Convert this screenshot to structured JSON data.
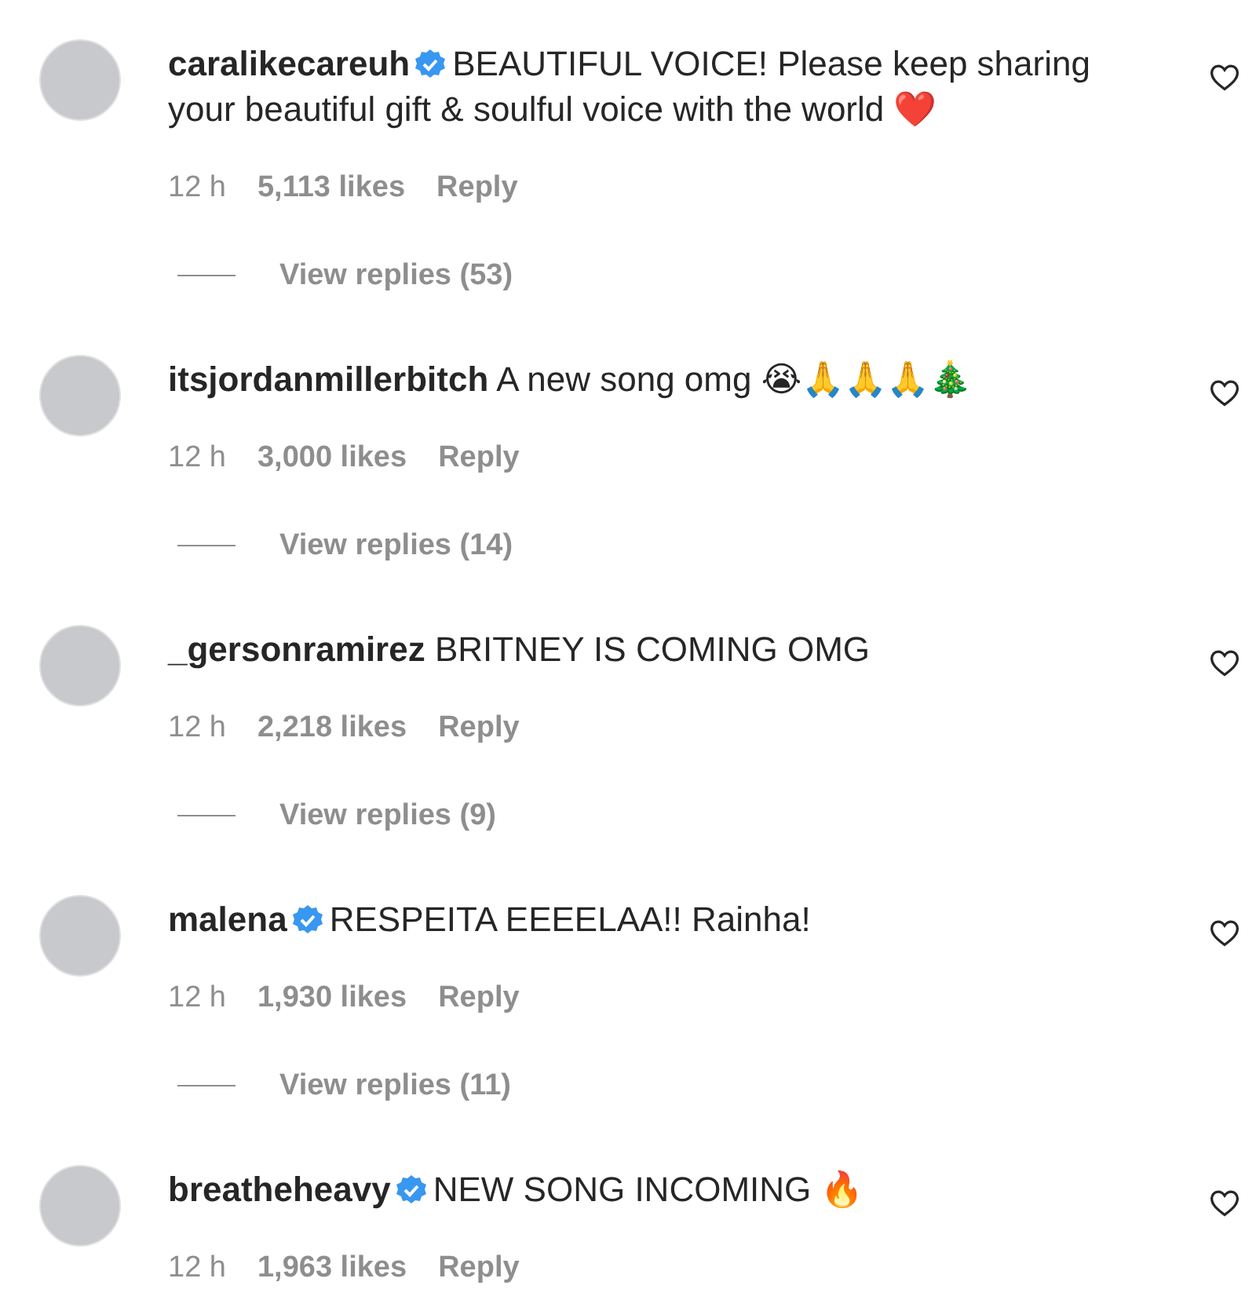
{
  "comments": [
    {
      "username": "caralikecareuh",
      "verified": true,
      "text": "BEAUTIFUL VOICE! Please keep sharing your beautiful gift & soulful voice with the world ❤️",
      "time": "12 h",
      "likes": "5,113 likes",
      "reply": "Reply",
      "liked": false,
      "view_replies": "View replies (53)"
    },
    {
      "username": "itsjordanmillerbitch",
      "verified": false,
      "text": "A new song omg 😭🙏🙏🙏🎄",
      "time": "12 h",
      "likes": "3,000 likes",
      "reply": "Reply",
      "liked": false,
      "view_replies": "View replies (14)"
    },
    {
      "username": "_gersonramirez",
      "verified": false,
      "text": "BRITNEY IS COMING OMG",
      "time": "12 h",
      "likes": "2,218 likes",
      "reply": "Reply",
      "liked": false,
      "view_replies": "View replies (9)"
    },
    {
      "username": "malena",
      "verified": true,
      "text": "RESPEITA EEEELAA!! Rainha!",
      "time": "12 h",
      "likes": "1,930 likes",
      "reply": "Reply",
      "liked": false,
      "view_replies": "View replies (11)"
    },
    {
      "username": "breatheheavy",
      "verified": true,
      "text": "NEW SONG INCOMING 🔥",
      "time": "12 h",
      "likes": "1,963 likes",
      "reply": "Reply",
      "liked": false
    }
  ]
}
